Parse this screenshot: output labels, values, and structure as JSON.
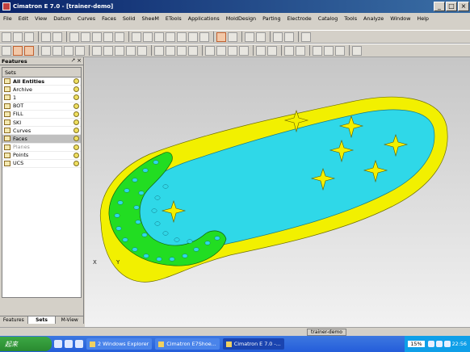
{
  "window": {
    "title": "Cimatron E 7.0 - [trainer-demo]"
  },
  "menu": [
    "File",
    "Edit",
    "View",
    "Datum",
    "Curves",
    "Faces",
    "Solid",
    "SheeM",
    "ETools",
    "Applications",
    "MoldDesign",
    "Parting",
    "Electrode",
    "Catalog",
    "Tools",
    "Analyze",
    "Window",
    "Help"
  ],
  "panel": {
    "title": "Features",
    "pin": "⭧ ×",
    "sets_header": "Sets",
    "items": [
      {
        "label": "All Entities",
        "bold": true
      },
      {
        "label": "Archive"
      },
      {
        "label": "1"
      },
      {
        "label": "BOT"
      },
      {
        "label": "FILL"
      },
      {
        "label": "SKI"
      },
      {
        "label": "Curves"
      },
      {
        "label": "Faces",
        "selected": true
      },
      {
        "label": "Planes",
        "dim": true
      },
      {
        "label": "Points"
      },
      {
        "label": "UCS"
      }
    ],
    "tabs": [
      "Features",
      "Sets",
      "M-View"
    ]
  },
  "viewport": {
    "axis_x": "X",
    "axis_y": "Y"
  },
  "status": {
    "doc": "trainer-demo"
  },
  "taskbar": {
    "start": "起来",
    "tasks": [
      "2 Windows Explorer",
      "Cimatron E7Shoe...",
      "Cimatron E 7.0 -..."
    ],
    "zoom": "15%",
    "clock": "22:56"
  },
  "colors": {
    "shell": "#f2f000",
    "inner": "#2fd8e8",
    "rim": "#22dd22",
    "dots": "#2fd8e8",
    "title": "#0a246a"
  }
}
